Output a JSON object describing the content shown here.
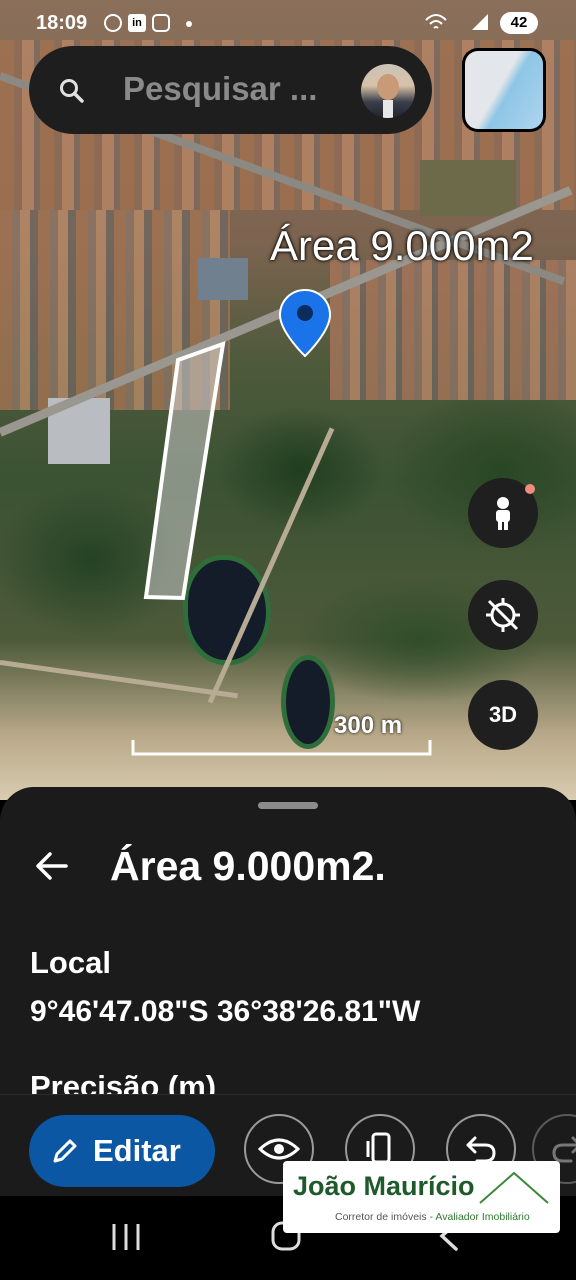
{
  "status_bar": {
    "time": "18:09",
    "battery": "42"
  },
  "search": {
    "placeholder": "Pesquisar ..."
  },
  "map": {
    "place_label": "Área 9.000m2",
    "scale_label": "300 m"
  },
  "controls": {
    "view_3d_label": "3D"
  },
  "card": {
    "title": "Área 9.000m2.",
    "local_label": "Local",
    "coordinates": "9°46'47.08\"S 36°38'26.81\"W",
    "precision_label": "Precisão (m)"
  },
  "toolbar": {
    "edit_label": "Editar"
  },
  "watermark": {
    "name": "João Maurício",
    "subtitle_a": "Corretor de imóveis - ",
    "subtitle_b": "Avaliador Imobiliário"
  },
  "colors": {
    "accent": "#0b57a4",
    "pin": "#1a73e8",
    "background": "#1b1b1b"
  }
}
